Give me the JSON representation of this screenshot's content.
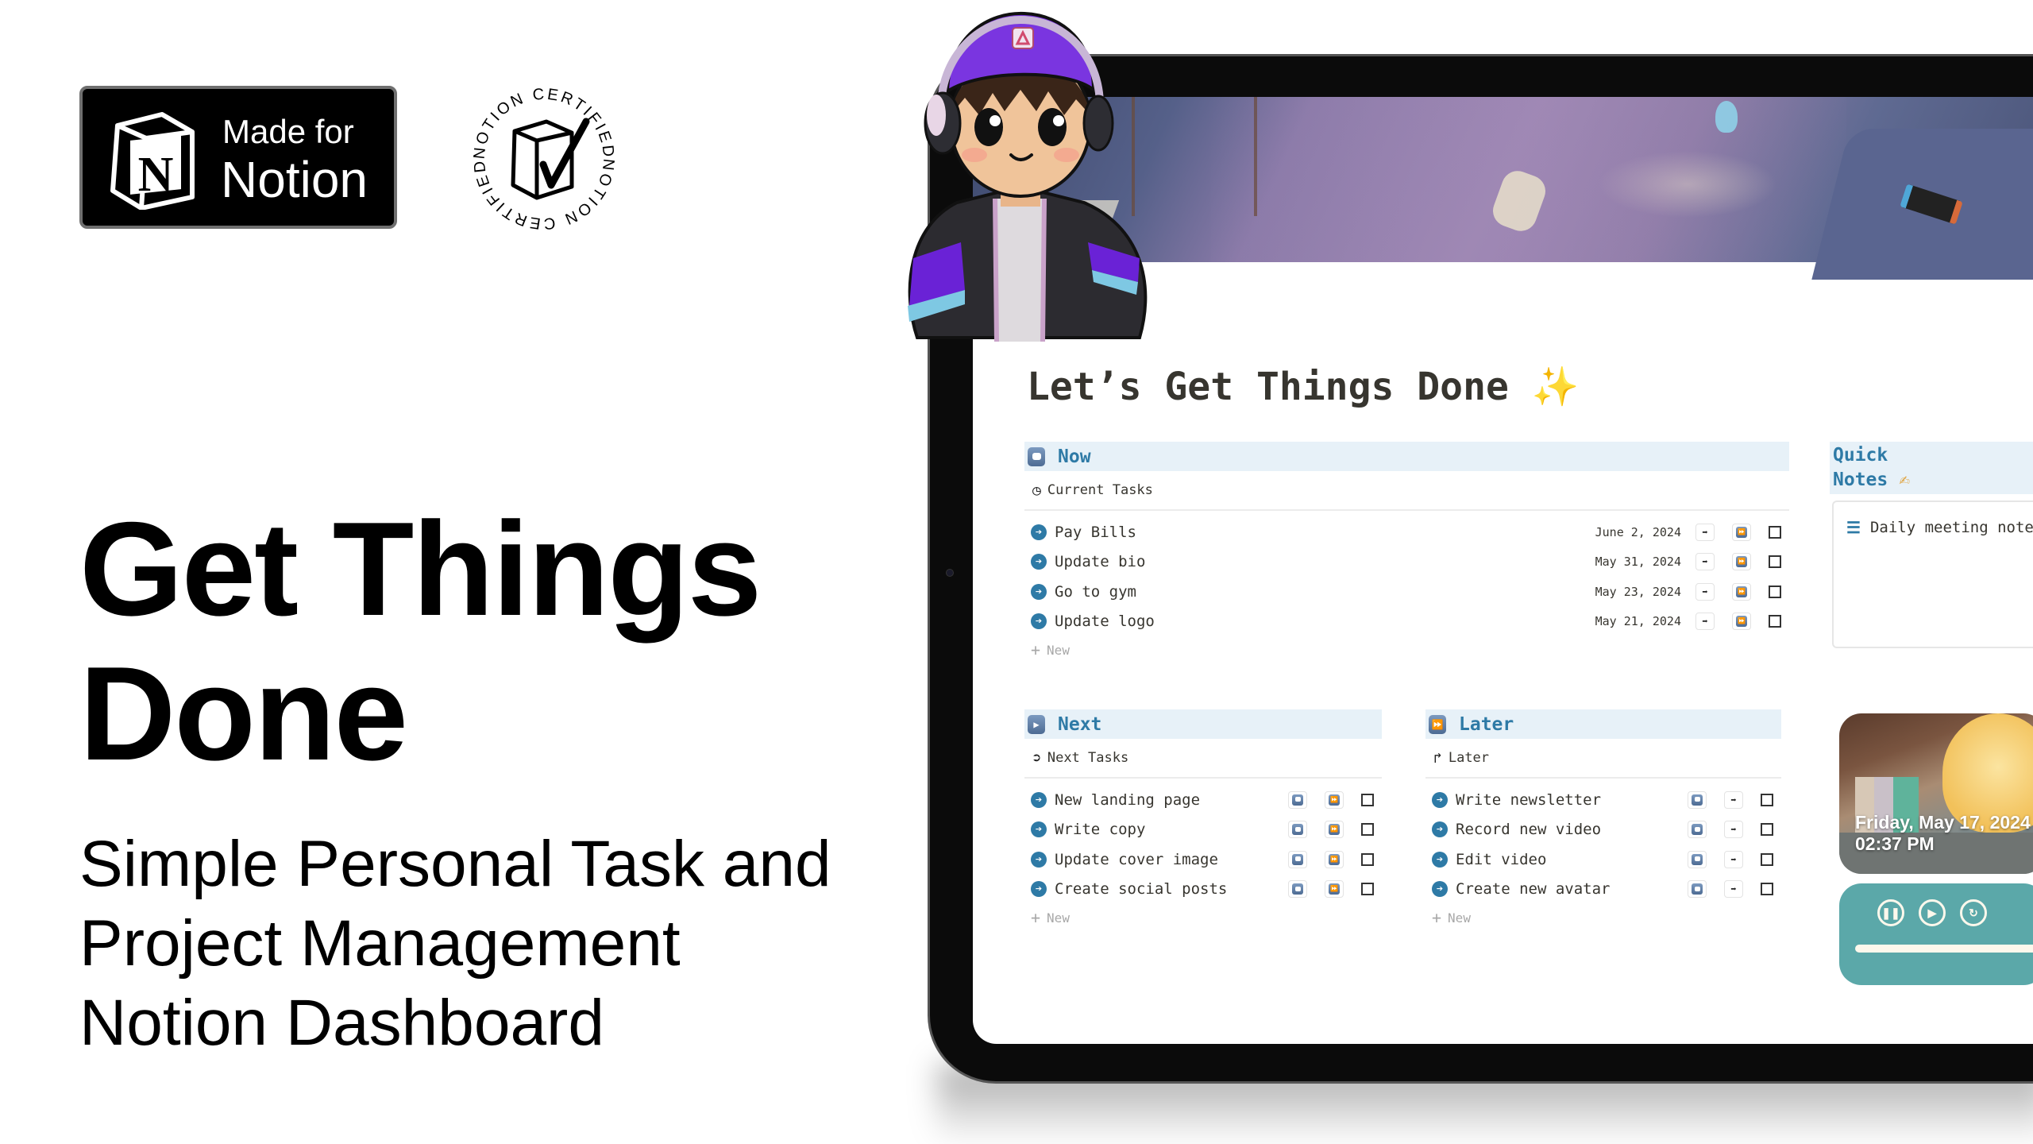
{
  "promo": {
    "badge": {
      "line1": "Made for",
      "line2": "Notion"
    },
    "seal": {
      "top_text": "NOTION CERTIFIED",
      "bottom_text": "NOTION CERTIFIED"
    },
    "title_line1": "Get Things",
    "title_line2": "Done",
    "subtitle_line1": "Simple Personal Task and",
    "subtitle_line2": "Project Management",
    "subtitle_line3": "Notion Dashboard"
  },
  "page": {
    "title": "Let’s Get Things Done",
    "title_emoji": "✨"
  },
  "sections": {
    "now": {
      "title": "Now",
      "icon": "record-button-icon",
      "view": "Current Tasks",
      "view_icon": "clock-icon",
      "tasks": [
        {
          "name": "Pay Bills",
          "date": "June 2, 2024"
        },
        {
          "name": "Update bio",
          "date": "May 31, 2024"
        },
        {
          "name": "Go to gym",
          "date": "May 23, 2024"
        },
        {
          "name": "Update logo",
          "date": "May 21, 2024"
        }
      ],
      "btn1": "➡",
      "btn2": "⏩",
      "new_label": "New"
    },
    "next": {
      "title": "Next",
      "icon": "play-button-icon",
      "view": "Next Tasks",
      "view_icon": "arrow-circle-icon",
      "tasks": [
        {
          "name": "New landing page"
        },
        {
          "name": "Write copy"
        },
        {
          "name": "Update cover image"
        },
        {
          "name": "Create social posts"
        }
      ],
      "btn1": "⏺",
      "btn2": "⏩",
      "new_label": "New"
    },
    "later": {
      "title": "Later",
      "icon": "fast-forward-icon",
      "view": "Later",
      "view_icon": "redo-arrow-icon",
      "tasks": [
        {
          "name": "Write newsletter"
        },
        {
          "name": "Record new video"
        },
        {
          "name": "Edit video"
        },
        {
          "name": "Create new avatar"
        }
      ],
      "btn1": "⏺",
      "btn2": "➡",
      "new_label": "New"
    }
  },
  "quick_notes": {
    "title_line1": "Quick",
    "title_line2": "Notes",
    "title_emoji": "✍",
    "notes": [
      "Daily meeting notes"
    ]
  },
  "widget": {
    "date": "Friday, May 17, 2024",
    "time": "02:37 PM"
  },
  "player": {
    "progress": 1.0
  },
  "colors": {
    "accent": "#2e7aa6",
    "header_bg": "#e7f1f8",
    "player_bg": "#5ba8a9",
    "text": "#37352f"
  }
}
